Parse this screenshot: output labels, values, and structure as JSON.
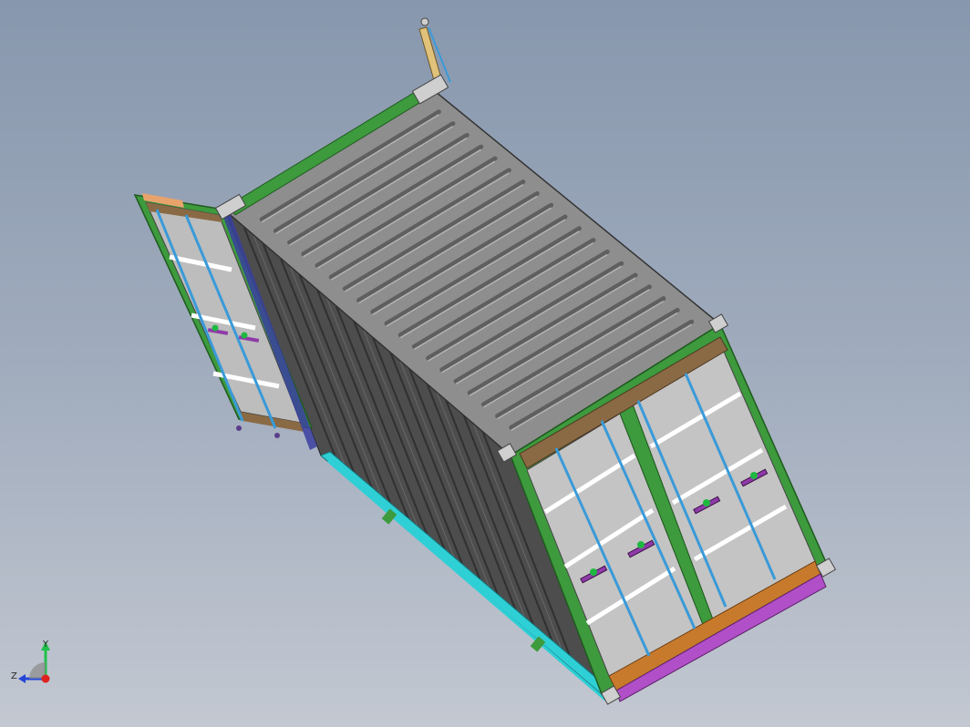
{
  "viewport": {
    "background_top": "#8797ad",
    "background_bottom": "#c3c8d1"
  },
  "model": {
    "body_color": "#5d5d5d",
    "roof_color": "#8e8e8e",
    "side_rail_color": "#3d9a3d",
    "bottom_rail_color": "#2fcfd6",
    "threshold_color": "#c87a2c",
    "sill_color": "#b04fc7",
    "door_panel_color": "#bfbfbf",
    "lock_rod_color": "#3a9ad8"
  },
  "triad": {
    "y_label": "Y",
    "z_label": "Z",
    "x_color": "#e0221e",
    "y_color": "#1fc14a",
    "z_color": "#2346d6"
  }
}
